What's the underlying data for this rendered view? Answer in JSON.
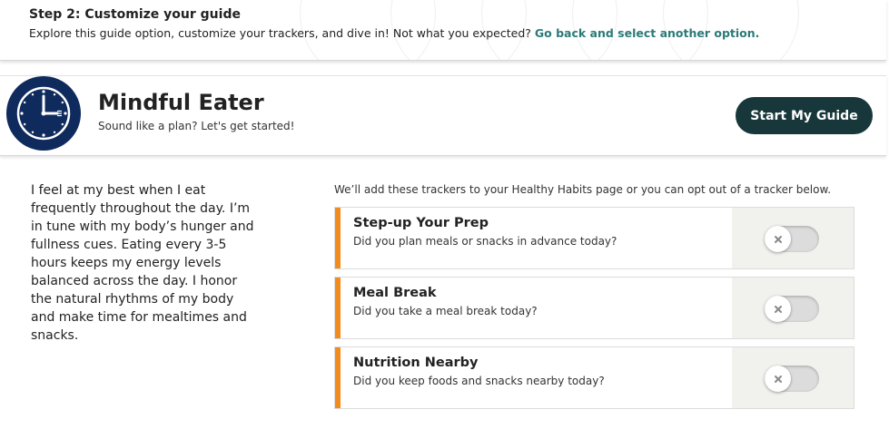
{
  "step": {
    "title": "Step 2: Customize your guide",
    "description": "Explore this guide option, customize your trackers, and dive in! Not what you expected?",
    "link": "Go back and select another option."
  },
  "guide": {
    "icon": "clock-fork-knife-icon",
    "title": "Mindful Eater",
    "subtitle": "Sound like a plan? Let's get started!",
    "start_button": "Start My Guide",
    "description": "I feel at my best when I eat frequently throughout the day. I’m in tune with my body’s hunger and fullness cues. Eating every 3-5 hours keeps my energy levels balanced across the day. I honor the natural rhythms of my body and make time for mealtimes and snacks."
  },
  "trackers": {
    "intro": "We’ll add these trackers to your Healthy Habits page or you can opt out of a tracker below.",
    "items": [
      {
        "title": "Step-up Your Prep",
        "question": "Did you plan meals or snacks in advance today?",
        "enabled": false
      },
      {
        "title": "Meal Break",
        "question": "Did you take a meal break today?",
        "enabled": false
      },
      {
        "title": "Nutrition Nearby",
        "question": "Did you keep foods and snacks nearby today?",
        "enabled": false
      }
    ]
  },
  "colors": {
    "brand_dark": "#17373a",
    "icon_navy": "#0f2a5c",
    "link": "#2b7a78",
    "accent": "#f28c1e"
  }
}
